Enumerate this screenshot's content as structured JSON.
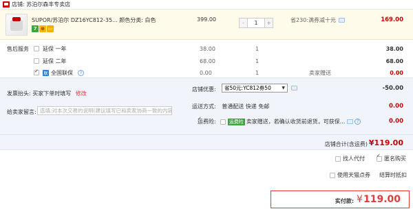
{
  "shop": {
    "label": "店铺: 苏泊尔森丰专卖店"
  },
  "item": {
    "title": "SUPOR/苏泊尔 DZ16YC812-35...   颜色分类: 白色",
    "badges": [
      "7",
      "⊕",
      "▭"
    ],
    "unit_price": "399.00",
    "quantity": "1",
    "minus": "-",
    "plus": "+",
    "discount": "省230:满券减十元",
    "subtotal": "169.00"
  },
  "services": {
    "category": "售后服务",
    "rows": [
      {
        "name": "延保 一年",
        "checked": false,
        "price": "38.00",
        "qty": "1",
        "note": "",
        "total": "38.00",
        "red": false
      },
      {
        "name": "延保 二年",
        "checked": false,
        "price": "68.00",
        "qty": "1",
        "note": "",
        "total": "68.00",
        "red": false
      },
      {
        "name": "全国联保",
        "checked": true,
        "price": "0.00",
        "qty": "1",
        "note": "卖家赠送",
        "total": "0.00",
        "red": true
      }
    ]
  },
  "invoice": {
    "label": "发票抬头:",
    "value": "买家下单时填写",
    "action": "修改"
  },
  "message": {
    "label": "给卖家留言:",
    "placeholder": "选填:对本次交易的说明(建议填写已和卖家协商一致的内容)"
  },
  "store_discount": {
    "label": "店铺优惠:",
    "selected": "省50元:YC812券50",
    "amount": "-50.00"
  },
  "shipping": {
    "label": "运送方式:",
    "value": "普通配送 快递 免邮",
    "amount": "0.00"
  },
  "insurance": {
    "label": "运费险:",
    "tag": "运费险",
    "value": "卖家赠送，若确认收货前退货，可获保...",
    "amount": "0.00"
  },
  "store_total": {
    "label": "店铺合计(含运费)",
    "value": "¥119.00"
  },
  "options": {
    "proxy_pay": "找人代付",
    "anonymous": "匿名购买",
    "tmall_points": "使用天猫点券",
    "settle_later": "结算时抵扣"
  },
  "payment": {
    "label": "实付款:",
    "currency": "¥",
    "value": "119.00"
  }
}
